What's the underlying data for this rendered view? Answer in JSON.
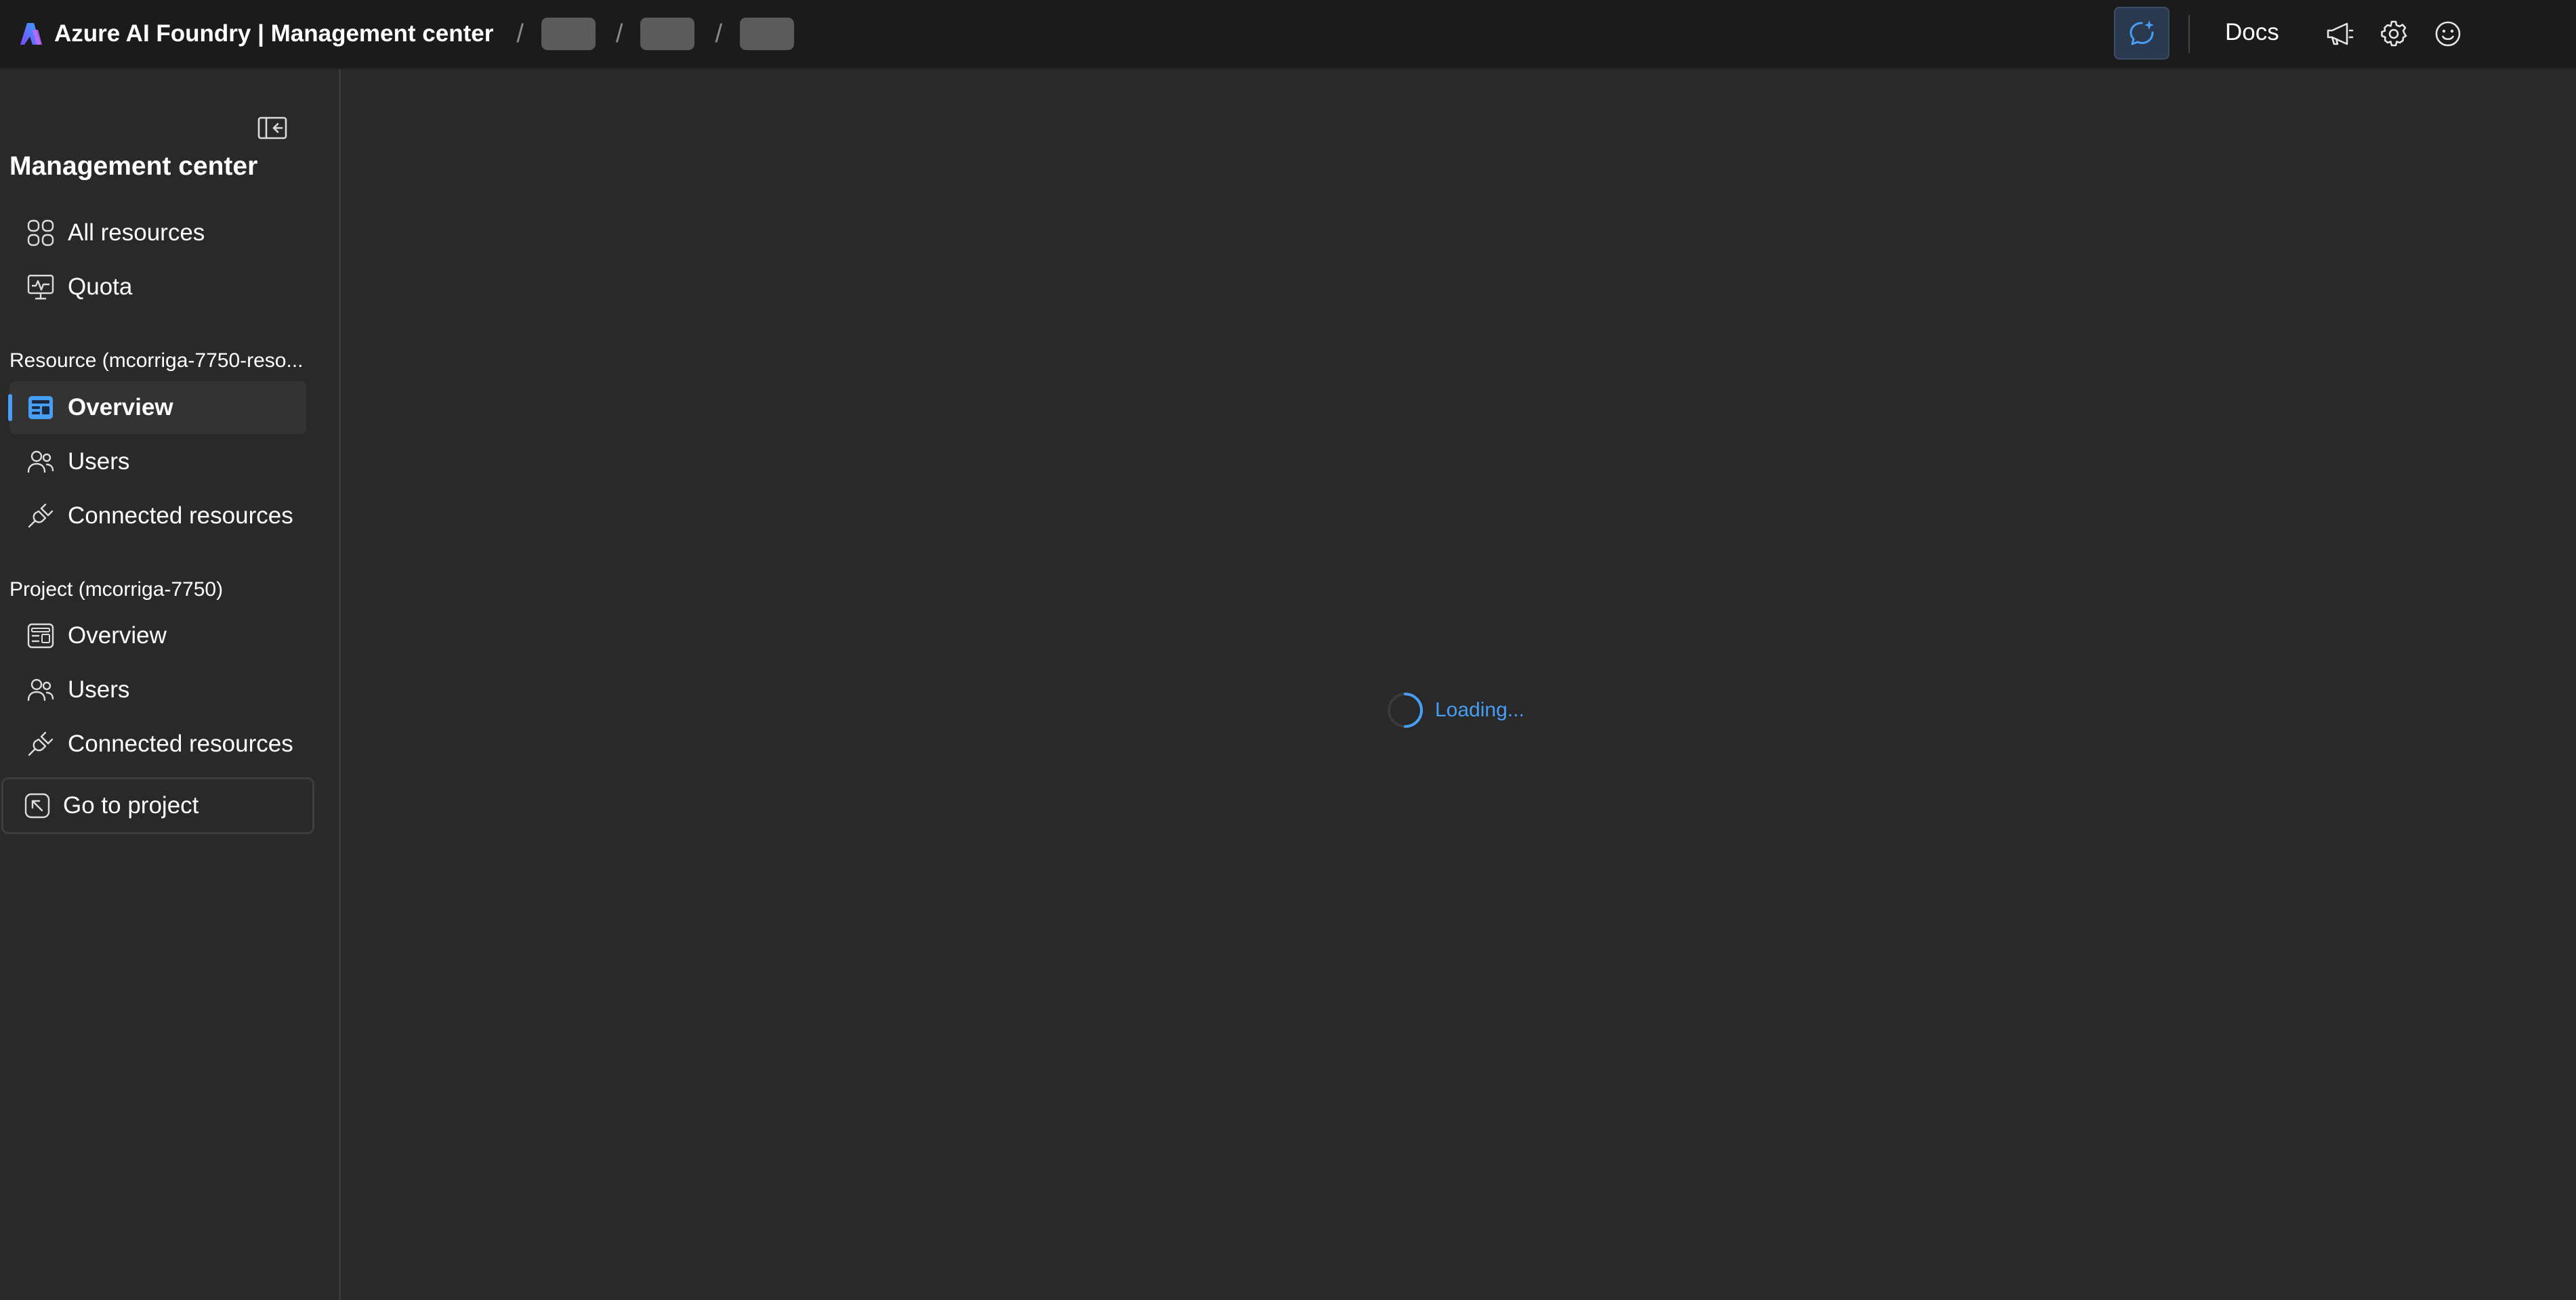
{
  "header": {
    "title": "Azure AI Foundry | Management center",
    "breadcrumb_separator": "/",
    "docs_label": "Docs",
    "icons": [
      "azure-ai-foundry-logo",
      "copilot-chat-icon",
      "megaphone-icon",
      "gear-icon",
      "smiley-icon"
    ]
  },
  "sidebar": {
    "title": "Management center",
    "top_items": [
      {
        "label": "All resources",
        "icon": "grid-icon"
      },
      {
        "label": "Quota",
        "icon": "monitor-pulse-icon"
      }
    ],
    "resource_section": {
      "label": "Resource (mcorriga-7750-reso...",
      "items": [
        {
          "label": "Overview",
          "icon": "overview-icon",
          "active": true
        },
        {
          "label": "Users",
          "icon": "people-icon"
        },
        {
          "label": "Connected resources",
          "icon": "plug-icon"
        }
      ]
    },
    "project_section": {
      "label": "Project (mcorriga-7750)",
      "items": [
        {
          "label": "Overview",
          "icon": "overview-icon"
        },
        {
          "label": "Users",
          "icon": "people-icon"
        },
        {
          "label": "Connected resources",
          "icon": "plug-icon"
        }
      ]
    },
    "go_to_project_label": "Go to project"
  },
  "main": {
    "loading_text": "Loading..."
  },
  "colors": {
    "accent": "#479ef5",
    "background": "#292929",
    "topbar": "#1b1b1b"
  }
}
